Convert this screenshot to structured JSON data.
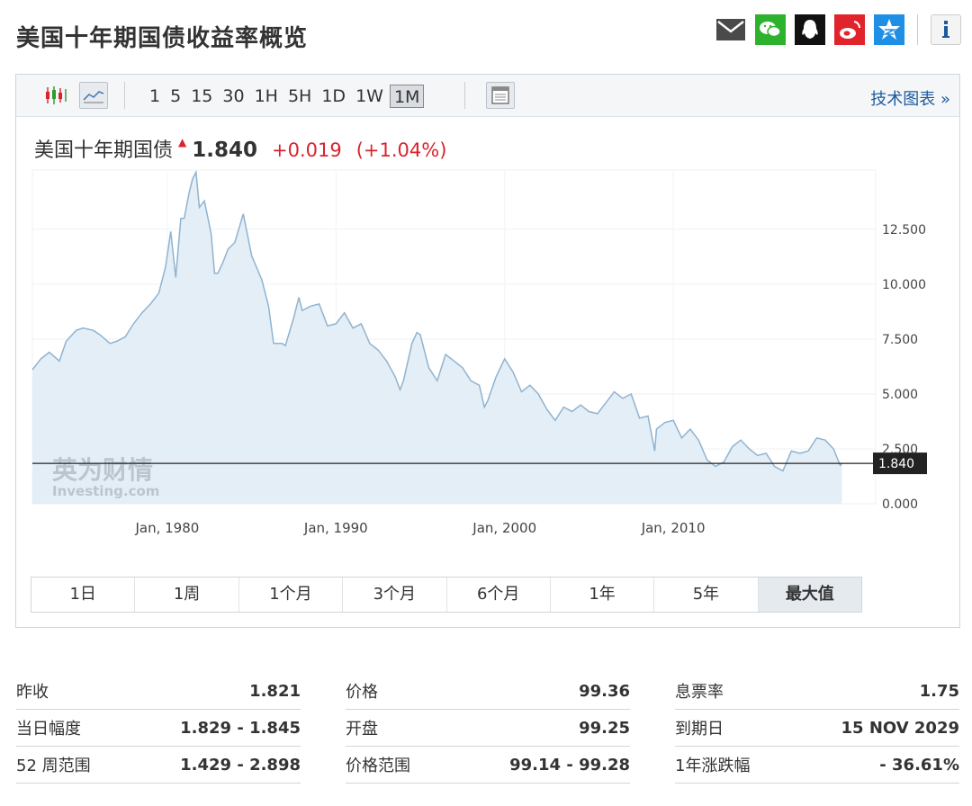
{
  "page": {
    "title": "美国十年期国债收益率概览"
  },
  "share_icons": [
    "mail-icon",
    "wechat-icon",
    "qq-icon",
    "weibo-icon",
    "qzone-icon",
    "info-icon"
  ],
  "toolbar": {
    "intervals": [
      "1",
      "5",
      "15",
      "30",
      "1H",
      "5H",
      "1D",
      "1W",
      "1M"
    ],
    "active_interval": "1M",
    "tech_chart_link": "技术图表 »"
  },
  "quote": {
    "name": "美国十年期国债",
    "price": "1.840",
    "change": "+0.019",
    "change_pct": "(+1.04%)"
  },
  "watermark": {
    "cn": "英为财情",
    "en": "Investing.com"
  },
  "chart_data": {
    "type": "area",
    "x_tick_labels": [
      "Jan, 1980",
      "Jan, 1990",
      "Jan, 2000",
      "Jan, 2010"
    ],
    "y_tick_labels": [
      "12.500",
      "10.000",
      "7.500",
      "5.000",
      "2.500",
      "0.000"
    ],
    "y_ticks": [
      12.5,
      10,
      7.5,
      5,
      2.5,
      0
    ],
    "ylim": [
      0,
      15.2
    ],
    "xlim": [
      1972,
      2022
    ],
    "last_value_label": "1.840",
    "current_value": 1.84,
    "series": [
      {
        "x": [
          1972,
          1972.5,
          1973,
          1973.6,
          1974,
          1974.6,
          1975,
          1975.6,
          1976,
          1976.6,
          1977,
          1977.5,
          1978,
          1978.5,
          1979,
          1979.5,
          1979.9,
          1980.2,
          1980.5,
          1980.8,
          1981,
          1981.3,
          1981.5,
          1981.7,
          1981.9,
          1982.2,
          1982.6,
          1982.8,
          1983,
          1983.3,
          1983.6,
          1984,
          1984.5,
          1985,
          1985.6,
          1986,
          1986.3,
          1986.8,
          1987,
          1987.5,
          1987.8,
          1988,
          1988.5,
          1989,
          1989.5,
          1990,
          1990.5,
          1991,
          1991.5,
          1992,
          1992.5,
          1993,
          1993.5,
          1993.8,
          1994,
          1994.5,
          1994.8,
          1995,
          1995.5,
          1996,
          1996.5,
          1997,
          1997.5,
          1998,
          1998.5,
          1998.8,
          1999,
          1999.5,
          2000,
          2000.5,
          2001,
          2001.5,
          2002,
          2002.5,
          2003,
          2003.5,
          2004,
          2004.5,
          2005,
          2005.5,
          2006,
          2006.5,
          2007,
          2007.5,
          2008,
          2008.5,
          2008.9,
          2009,
          2009.5,
          2010,
          2010.5,
          2011,
          2011.5,
          2012,
          2012.5,
          2013,
          2013.5,
          2014,
          2014.5,
          2015,
          2015.5,
          2016,
          2016.5,
          2017,
          2017.5,
          2018,
          2018.5,
          2019,
          2019.5,
          2019.9,
          2020
        ],
        "y": [
          6.1,
          6.6,
          6.9,
          6.5,
          7.4,
          7.9,
          8.0,
          7.9,
          7.7,
          7.3,
          7.4,
          7.6,
          8.2,
          8.7,
          9.1,
          9.6,
          10.8,
          12.4,
          10.3,
          13.0,
          13.0,
          14.2,
          14.8,
          15.1,
          13.5,
          13.8,
          12.3,
          10.5,
          10.5,
          11.0,
          11.6,
          11.9,
          13.2,
          11.3,
          10.2,
          9.0,
          7.3,
          7.3,
          7.2,
          8.5,
          9.4,
          8.8,
          9.0,
          9.1,
          8.1,
          8.2,
          8.7,
          8.0,
          8.2,
          7.3,
          7.0,
          6.5,
          5.8,
          5.2,
          5.6,
          7.3,
          7.8,
          7.7,
          6.2,
          5.6,
          6.8,
          6.5,
          6.2,
          5.6,
          5.4,
          4.4,
          4.7,
          5.8,
          6.6,
          6.0,
          5.1,
          5.4,
          5.0,
          4.3,
          3.8,
          4.4,
          4.2,
          4.5,
          4.2,
          4.1,
          4.6,
          5.1,
          4.8,
          5.0,
          3.9,
          4.0,
          2.4,
          3.4,
          3.7,
          3.8,
          3.0,
          3.4,
          2.9,
          2.0,
          1.7,
          1.9,
          2.6,
          2.9,
          2.5,
          2.2,
          2.3,
          1.7,
          1.5,
          2.4,
          2.3,
          2.4,
          3.0,
          2.9,
          2.5,
          1.75,
          1.84
        ]
      }
    ]
  },
  "range_tabs": [
    "1日",
    "1周",
    "1个月",
    "3个月",
    "6个月",
    "1年",
    "5年",
    "最大值"
  ],
  "stats": [
    [
      {
        "label": "昨收",
        "value": "1.821"
      },
      {
        "label": "当日幅度",
        "value": "1.829 - 1.845"
      },
      {
        "label": "52 周范围",
        "value": "1.429 - 2.898"
      }
    ],
    [
      {
        "label": "价格",
        "value": "99.36"
      },
      {
        "label": "开盘",
        "value": "99.25"
      },
      {
        "label": "价格范围",
        "value": "99.14 - 99.28"
      }
    ],
    [
      {
        "label": "息票率",
        "value": "1.75"
      },
      {
        "label": "到期日",
        "value": "15 NOV 2029"
      },
      {
        "label": "1年涨跌幅",
        "value": "- 36.61%"
      }
    ]
  ],
  "colors": {
    "up_red": "#d9232d",
    "line_blue": "#8fb3d0",
    "fill_blue": "#e4eef6",
    "link_blue": "#1c5a9c"
  }
}
